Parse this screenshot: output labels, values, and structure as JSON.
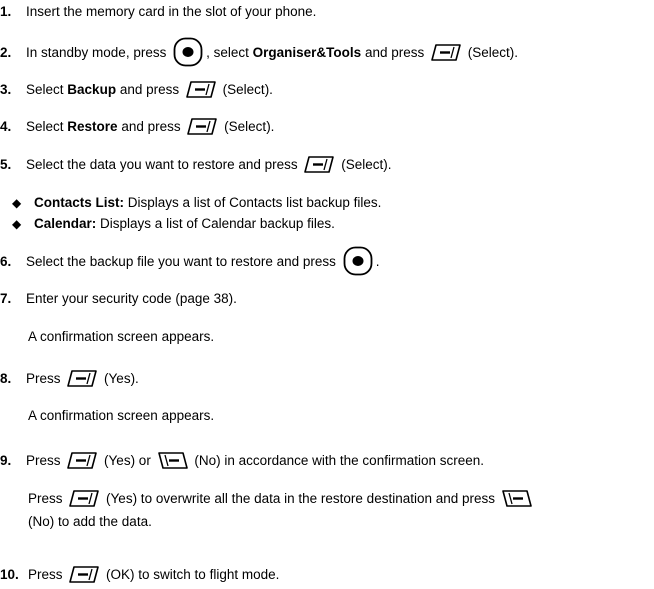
{
  "steps": [
    {
      "num": "1.",
      "text": "Insert the memory card in the slot of your phone."
    },
    {
      "num": "2.",
      "p1": "In standby mode, press",
      "p2": ", select",
      "bold": "Organiser&Tools",
      "p3": "and press",
      "p4": "(Select)."
    },
    {
      "num": "3.",
      "p1": "Select",
      "bold": "Backup",
      "p2": "and press",
      "p3": "(Select)."
    },
    {
      "num": "4.",
      "p1": "Select",
      "bold": "Restore",
      "p2": "and press",
      "p3": "(Select)."
    },
    {
      "num": "5.",
      "p1": "Select the data you want to restore and press",
      "p2": "(Select)."
    },
    {
      "num": "6.",
      "p1": "Select the backup file you want to restore and press",
      "p2": "."
    },
    {
      "num": "7.",
      "text": "Enter your security code (page 38).",
      "sub": "A confirmation screen appears."
    },
    {
      "num": "8.",
      "p1": "Press",
      "p2": "(Yes).",
      "sub": "A confirmation screen appears."
    },
    {
      "num": "9.",
      "p1": "Press",
      "p2": "(Yes) or",
      "p3": "(No) in accordance with the confirmation screen.",
      "sub_p1": "Press",
      "sub_p2": "(Yes) to overwrite all the data in the restore destination and press",
      "sub_p3": "(No) to add the data."
    },
    {
      "num": "10.",
      "p1": "Press",
      "p2": "(OK) to switch to flight mode."
    }
  ],
  "bullets": [
    {
      "glyph": "◆",
      "bold": "Contacts List:",
      "text": "Displays a list of Contacts list backup files."
    },
    {
      "glyph": "◆",
      "bold": "Calendar:",
      "text": "Displays a list of Calendar backup files."
    }
  ],
  "icons": {
    "center_key": "center-select-key-icon",
    "left_soft_key": "left-soft-key-icon",
    "right_soft_key": "right-soft-key-icon"
  }
}
